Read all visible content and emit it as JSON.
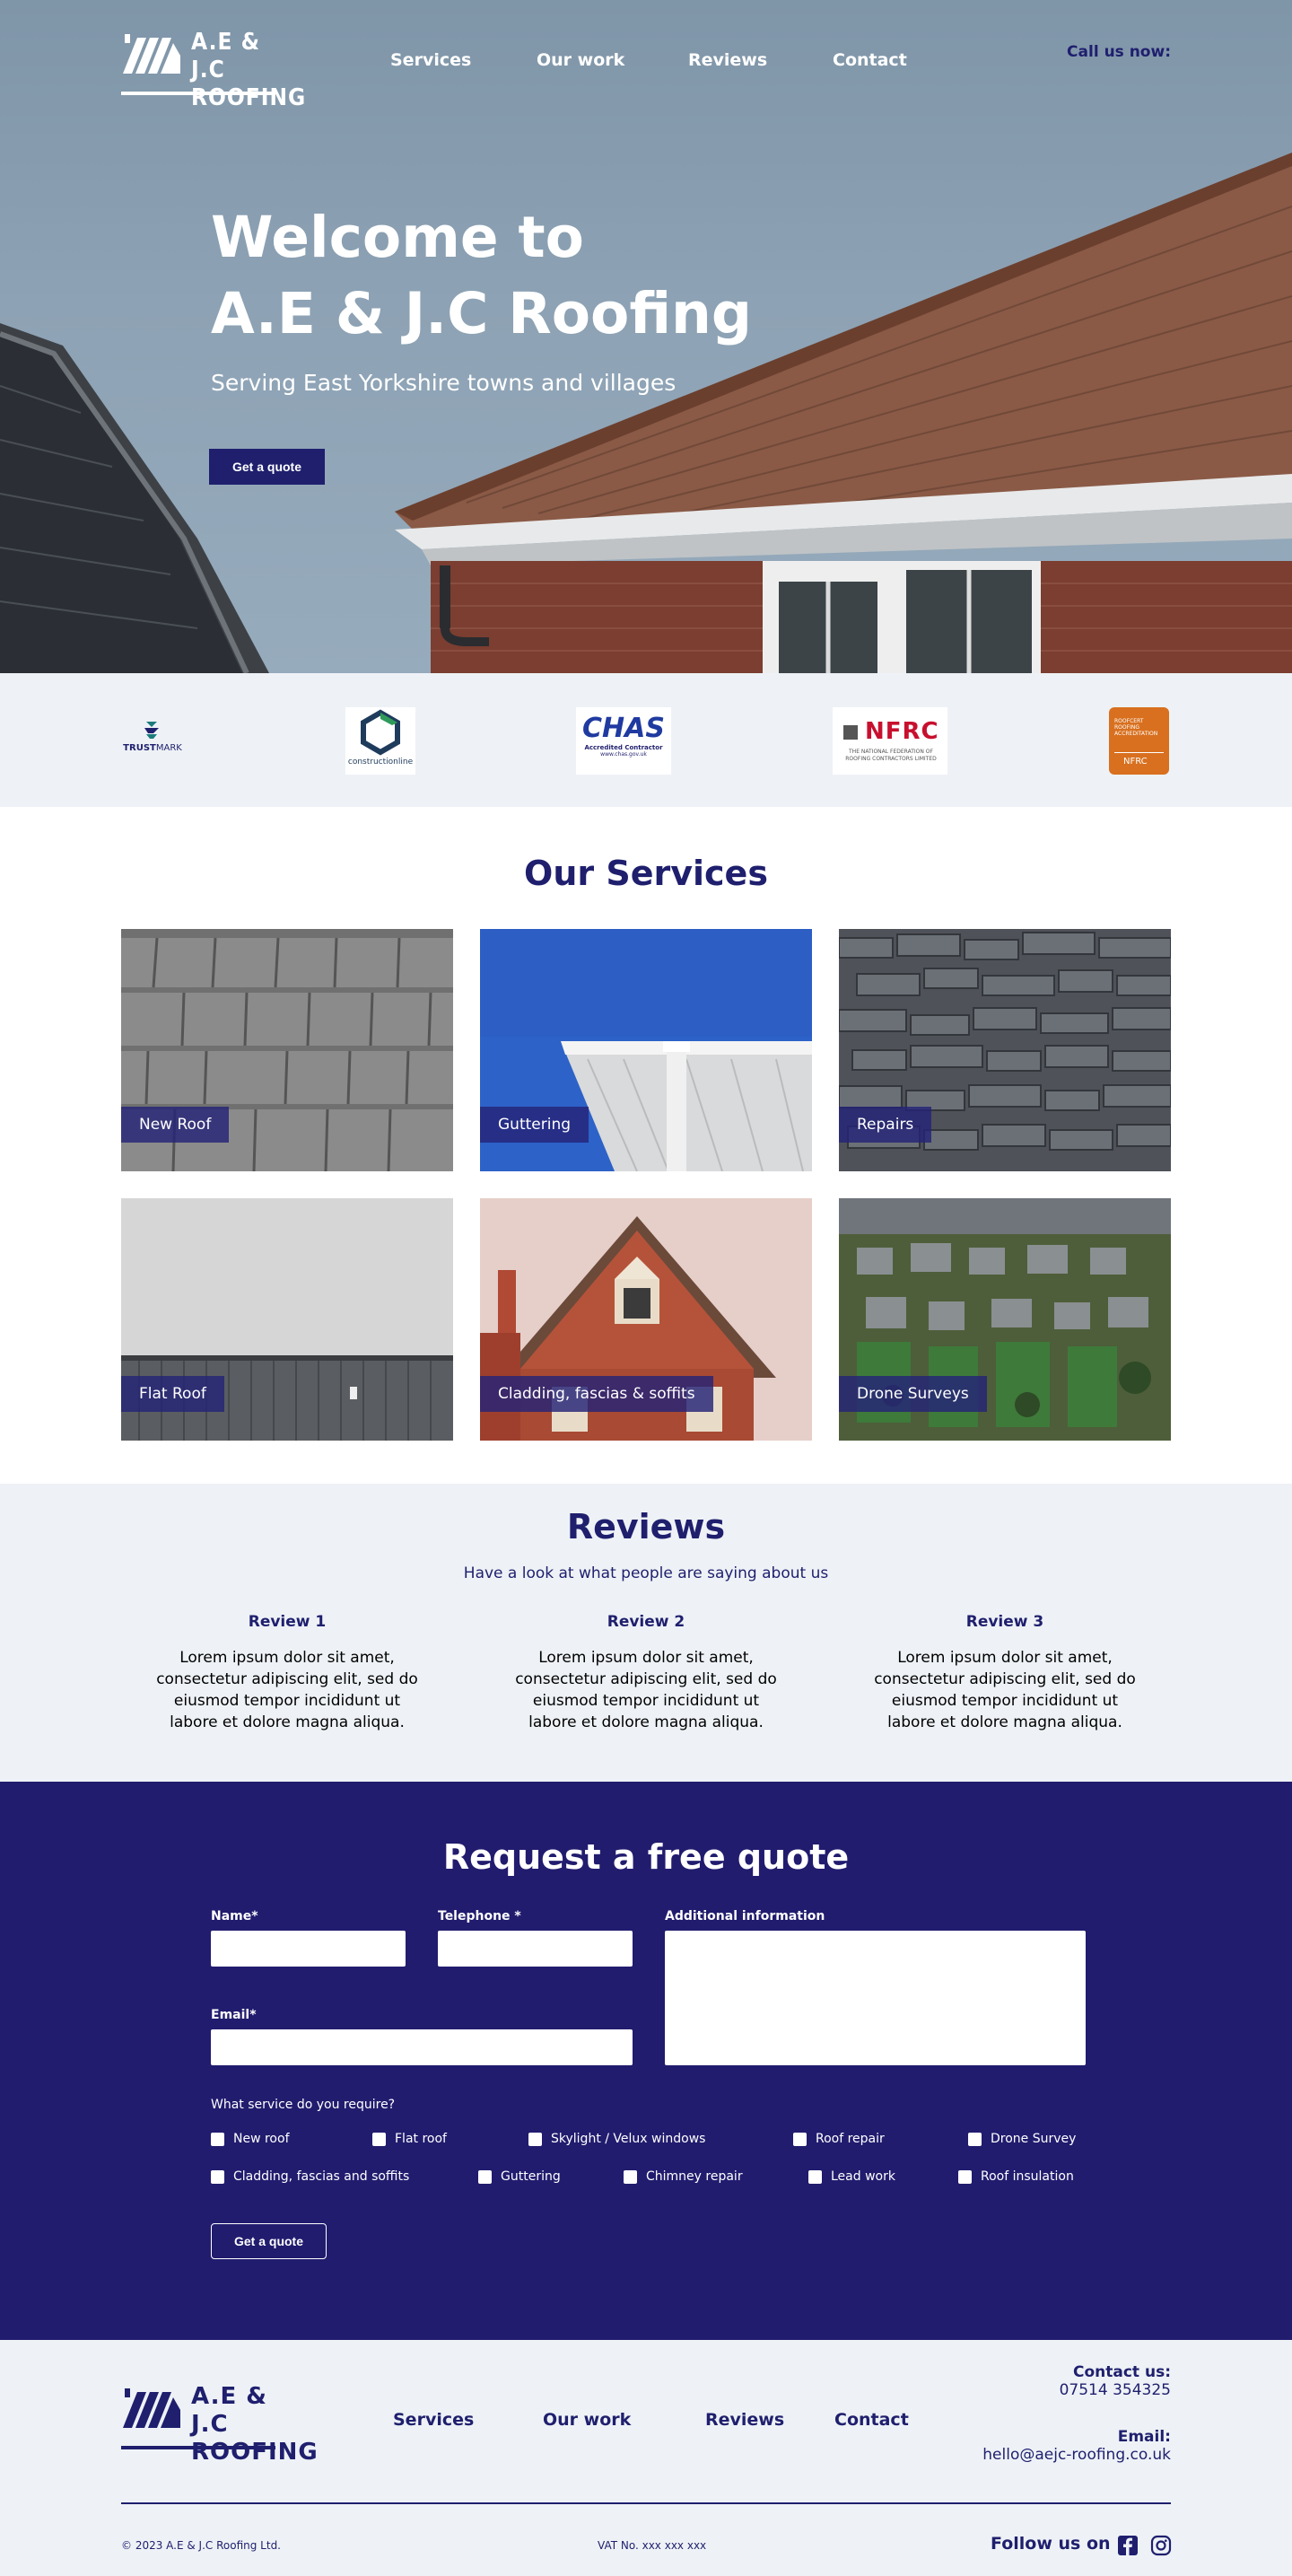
{
  "colors": {
    "brand_navy": "#1f1f6e",
    "form_bg": "#211c6e",
    "light_bg": "#eef2f6",
    "white": "#ffffff"
  },
  "header": {
    "logo_line1": "A.E & J.C",
    "logo_line2": "ROOFING",
    "nav": [
      "Services",
      "Our work",
      "Reviews",
      "Contact"
    ],
    "call_label": "Call us now:"
  },
  "hero": {
    "title_line1": "Welcome to",
    "title_line2": "A.E & J.C Roofing",
    "subtitle": "Serving East Yorkshire towns and villages",
    "cta": "Get a quote"
  },
  "accreditations": {
    "trustmark": {
      "name_a": "TRUST",
      "name_b": "MARK"
    },
    "constructionline": {
      "name": "constructionline"
    },
    "chas": {
      "name": "CHAS",
      "line1": "Accredited Contractor",
      "line2": "www.chas.gov.uk"
    },
    "nfrc": {
      "name": "NFRC",
      "sub1": "THE NATIONAL FEDERATION OF",
      "sub2": "ROOFING CONTRACTORS LIMITED"
    },
    "roofcert": {
      "line1": "ROOFCERT",
      "line2": "ROOFING",
      "line3": "ACCREDITATION",
      "foot": "NFRC"
    }
  },
  "services": {
    "title": "Our Services",
    "items": [
      "New Roof",
      "Guttering",
      "Repairs",
      "Flat  Roof",
      "Cladding, fascias & soffits",
      "Drone Surveys"
    ]
  },
  "reviews": {
    "title": "Reviews",
    "subtitle": "Have a look at what people are saying about us",
    "items": [
      {
        "title": "Review 1",
        "text": "Lorem ipsum dolor sit amet, consectetur adipiscing elit, sed do eiusmod tempor incididunt ut labore et dolore magna aliqua."
      },
      {
        "title": "Review 2",
        "text": "Lorem ipsum dolor sit amet, consectetur adipiscing elit, sed do eiusmod tempor incididunt ut labore et dolore magna aliqua."
      },
      {
        "title": "Review 3",
        "text": "Lorem ipsum dolor sit amet, consectetur adipiscing elit, sed do eiusmod tempor incididunt ut labore et dolore magna aliqua."
      }
    ]
  },
  "quote_form": {
    "title": "Request a free quote",
    "name_label": "Name*",
    "telephone_label": "Telephone *",
    "additional_label": "Additional information",
    "email_label": "Email*",
    "services_question": "What service do you require?",
    "options_row1": [
      "New roof",
      "Flat roof",
      "Skylight / Velux windows",
      "Roof repair",
      "Drone Survey"
    ],
    "options_row2": [
      "Cladding, fascias and soffits",
      "Guttering",
      "Chimney repair",
      "Lead work",
      "Roof insulation"
    ],
    "submit": "Get a quote"
  },
  "footer": {
    "nav": [
      "Services",
      "Our work",
      "Reviews",
      "Contact"
    ],
    "contact_label": "Contact us:",
    "phone": "07514 354325",
    "email_label": "Email:",
    "email": "hello@aejc-roofing.co.uk",
    "copyright": "© 2023 A.E & J.C Roofing Ltd.",
    "vat": "VAT No. xxx xxx xxx",
    "follow": "Follow us on",
    "social_icons": [
      "facebook-icon",
      "instagram-icon"
    ]
  }
}
